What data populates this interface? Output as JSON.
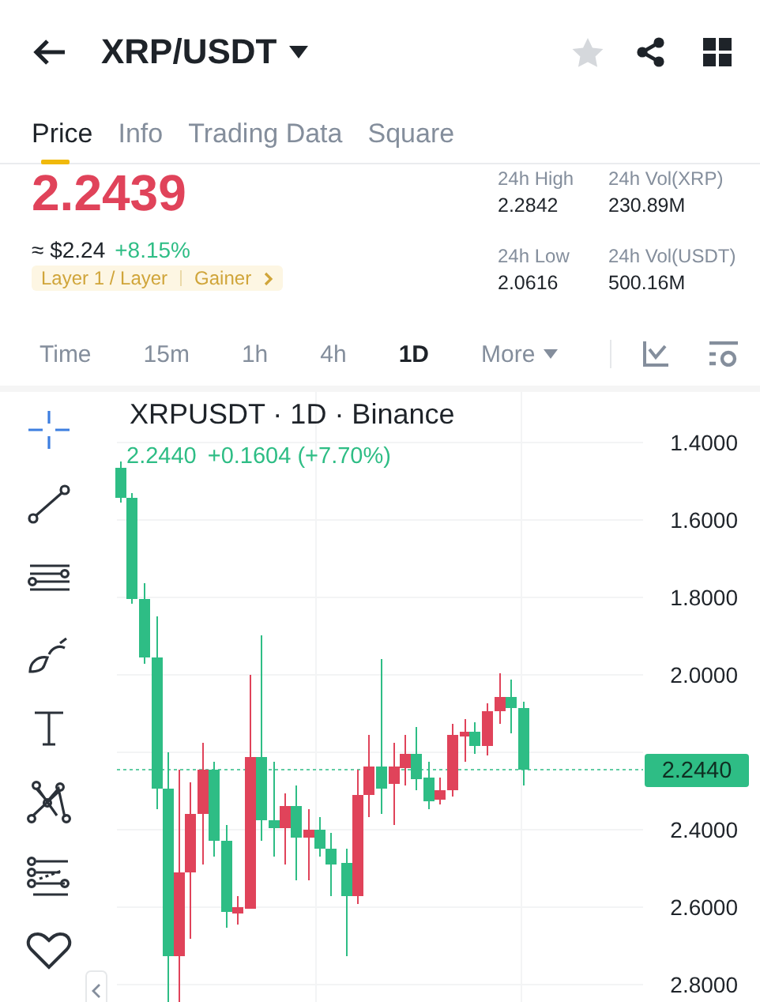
{
  "header": {
    "title": "XRP/USDT",
    "favorite": false
  },
  "tabs": [
    {
      "label": "Price",
      "selected": true
    },
    {
      "label": "Info",
      "selected": false
    },
    {
      "label": "Trading Data",
      "selected": false
    },
    {
      "label": "Square",
      "selected": false
    }
  ],
  "price": {
    "last": "2.2439",
    "fiat": "≈ $2.24",
    "change": "+8.15%"
  },
  "tags": [
    "Layer 1 / Layer",
    "Gainer"
  ],
  "stats": [
    {
      "label": "24h High",
      "value": "2.2842"
    },
    {
      "label": "24h Vol(XRP)",
      "value": "230.89M"
    },
    {
      "label": "24h Low",
      "value": "2.0616"
    },
    {
      "label": "24h Vol(USDT)",
      "value": "500.16M"
    }
  ],
  "intervals": [
    {
      "label": "Time",
      "selected": false
    },
    {
      "label": "15m",
      "selected": false
    },
    {
      "label": "1h",
      "selected": false
    },
    {
      "label": "4h",
      "selected": false
    },
    {
      "label": "1D",
      "selected": true
    },
    {
      "label": "More",
      "selected": false
    }
  ],
  "chart": {
    "title": "XRPUSDT · 1D · Binance",
    "last": "2.2440",
    "change": "+0.1604 (+7.70%)",
    "price_axis": [
      "1.4000",
      "1.6000",
      "1.8000",
      "2.0000",
      "2.4000",
      "2.6000",
      "2.8000"
    ],
    "price_tag": "2.2440"
  }
}
